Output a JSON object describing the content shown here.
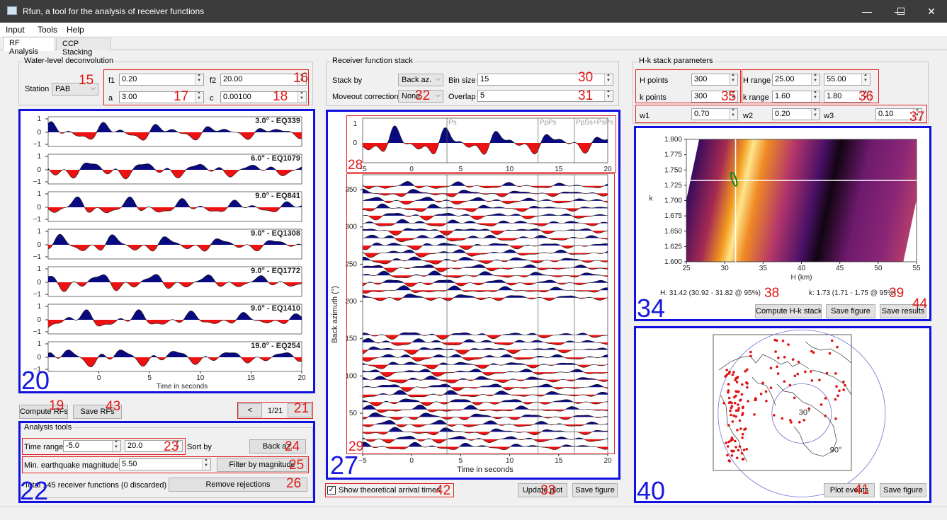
{
  "window": {
    "title": "Rfun, a tool for the analysis of receiver functions",
    "min": "—",
    "max": "☐",
    "close": "✕"
  },
  "menu": [
    "Input",
    "Tools",
    "Help"
  ],
  "tabs": [
    "RF Analysis",
    "CCP Stacking"
  ],
  "decon": {
    "title": "Water-level deconvolution",
    "station_label": "Station",
    "station_value": "PAB",
    "f1_label": "f1",
    "f1_value": "0.20",
    "f2_label": "f2",
    "f2_value": "20.00",
    "a_label": "a",
    "a_value": "3.00",
    "c_label": "c",
    "c_value": "0.00100"
  },
  "rf_plots": {
    "labels": [
      "3.0° - EQ339",
      "6.0° - EQ1079",
      "9.0° - EQ841",
      "9.0° - EQ1308",
      "9.0° - EQ1772",
      "9.0° - EQ1410",
      "19.0° - EQ254"
    ],
    "yticks": [
      "1",
      "0",
      "−1"
    ],
    "xticks": [
      "0",
      "5",
      "10",
      "15",
      "20"
    ],
    "xlabel": "Time in seconds"
  },
  "rf_buttons": {
    "compute": "Compute RFs",
    "save": "Save RFs",
    "prev": "<",
    "page": "1/21",
    "next": ""
  },
  "tools": {
    "title": "Analysis tools",
    "time_label": "Time range",
    "time_min": "-5.0",
    "time_max": "20.0",
    "sort_label": "Sort by",
    "sort_btn": "Back az.",
    "mag_label": "Min. earthquake magnitude",
    "mag_value": "5.50",
    "filter_btn": "Filter by magnitude",
    "total": "Total 145 receiver functions (0 discarded)",
    "remove_btn": "Remove rejections"
  },
  "stack": {
    "title": "Receiver function stack",
    "stackby_label": "Stack by",
    "stackby_value": "Back az.",
    "binsize_label": "Bin size",
    "binsize_value": "15",
    "moveout_label": "Moveout correction",
    "moveout_value": "None",
    "overlap_label": "Overlap",
    "overlap_value": "5",
    "phases": [
      "Ps",
      "PpPs",
      "PpSs+PsPs"
    ],
    "top_yticks": [
      "1",
      "0"
    ],
    "xticks": [
      "−5",
      "0",
      "5",
      "10",
      "15",
      "20"
    ],
    "baz_ticks": [
      "350",
      "300",
      "250",
      "200",
      "150",
      "100",
      "50"
    ],
    "ylabel": "Back azimuth (°)",
    "xlabel": "Time in seconds",
    "show_arrivals": "Show theoretical arrival times",
    "update_btn": "Update plot",
    "save_btn": "Save figure"
  },
  "hk_params": {
    "title": "H-k stack parameters",
    "hpoints_label": "H points",
    "hpoints_value": "300",
    "kpoints_label": "k points",
    "kpoints_value": "300",
    "hrange_label": "H range",
    "hrange_min": "25.00",
    "hrange_max": "55.00",
    "krange_label": "k range",
    "krange_min": "1.60",
    "krange_max": "1.80",
    "w1_label": "w1",
    "w1_value": "0.70",
    "w2_label": "w2",
    "w2_value": "0.20",
    "w3_label": "w3",
    "w3_value": "0.10"
  },
  "hk_plot": {
    "yticks": [
      "1.800",
      "1.775",
      "1.750",
      "1.725",
      "1.700",
      "1.675",
      "1.650",
      "1.625",
      "1.600"
    ],
    "xticks": [
      "25",
      "30",
      "35",
      "40",
      "45",
      "50",
      "55"
    ],
    "xlabel": "H (km)",
    "ylabel": "k",
    "h_result": "H: 31.42 (30.92 - 31.82 @ 95%)",
    "k_result": "k: 1.73 (1.71 - 1.75 @ 95%)",
    "compute_btn": "Compute H-k stack",
    "save_btn": "Save figure",
    "save_results": "Save results"
  },
  "map": {
    "ring1": "30°",
    "ring2": "90°",
    "plot_btn": "Plot events",
    "save_btn": "Save figure"
  },
  "annotations": {
    "red": [
      "15",
      "16",
      "17",
      "18",
      "19",
      "43",
      "21",
      "23",
      "24",
      "25",
      "26",
      "30",
      "32",
      "31",
      "28",
      "29",
      "33",
      "42",
      "35",
      "36",
      "37",
      "38",
      "39",
      "44",
      "41"
    ],
    "blue": [
      "20",
      "22",
      "27",
      "34",
      "40"
    ]
  },
  "colors": {
    "pos": "#0a0a80",
    "neg": "#ee1111",
    "annot_red": "#e01818",
    "annot_blue": "#1818e0"
  }
}
